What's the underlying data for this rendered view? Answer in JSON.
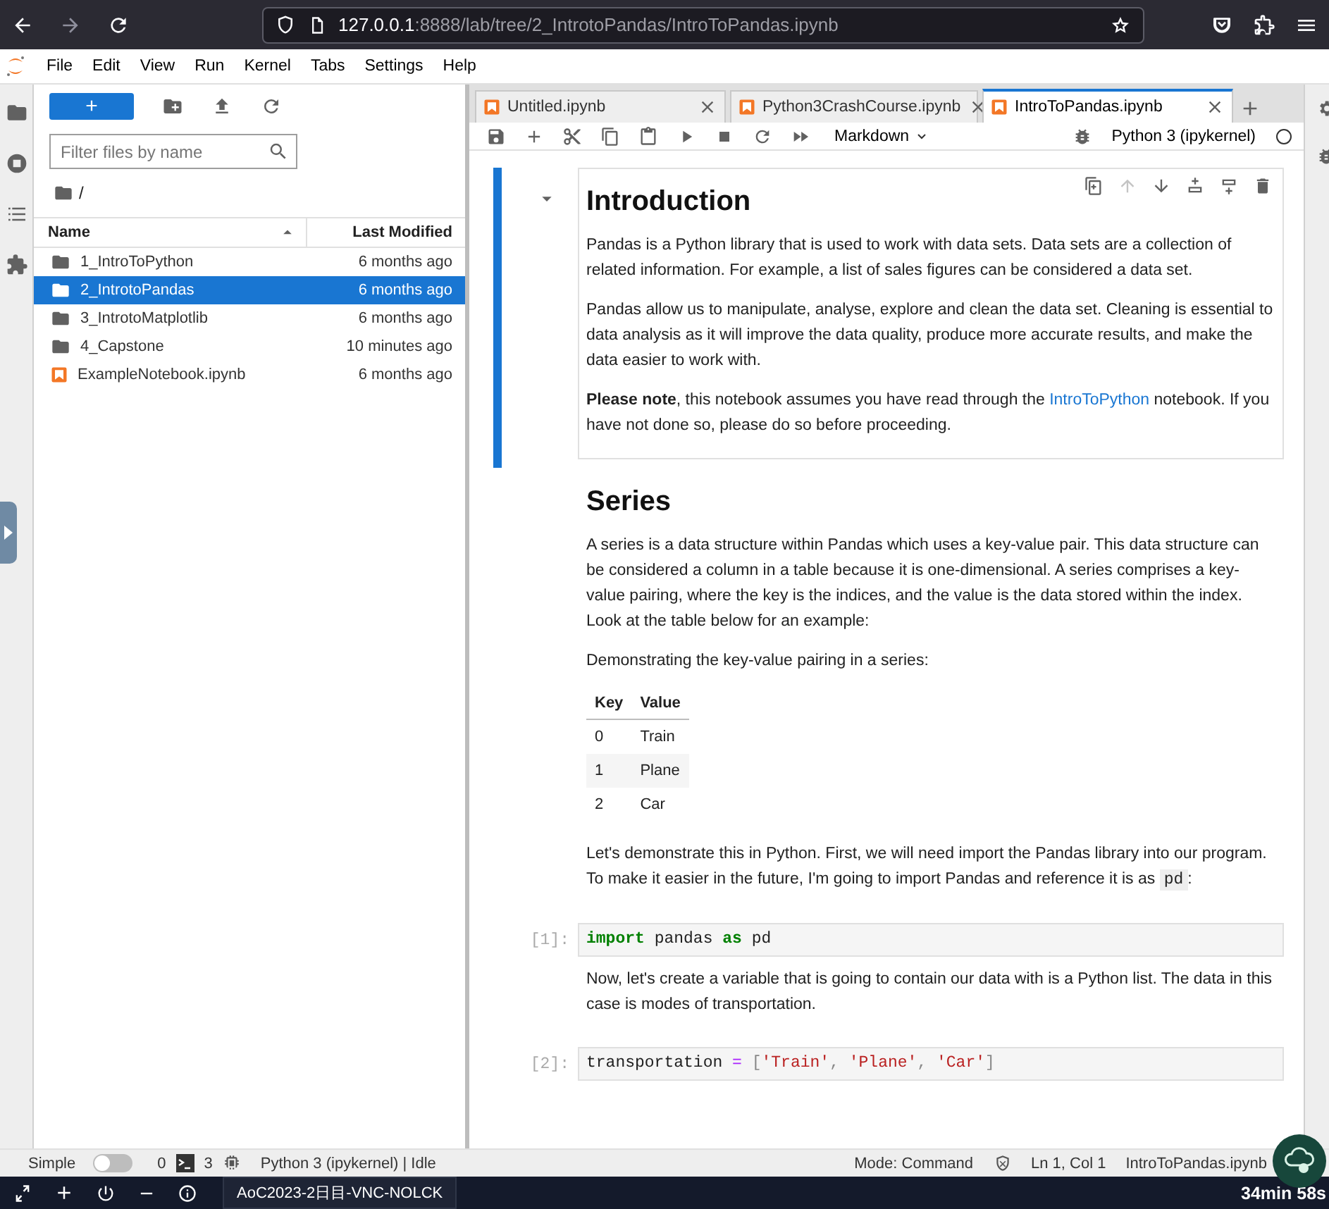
{
  "browser": {
    "url_host": "127.0.0.1",
    "url_path": ":8888/lab/tree/2_IntrotoPandas/IntroToPandas.ipynb"
  },
  "menu": [
    "File",
    "Edit",
    "View",
    "Run",
    "Kernel",
    "Tabs",
    "Settings",
    "Help"
  ],
  "file_browser": {
    "new_button": "+",
    "filter": {
      "placeholder": "Filter files by name"
    },
    "breadcrumb": "/",
    "columns": [
      "Name",
      "Last Modified"
    ],
    "files": [
      {
        "name": "1_IntroToPython",
        "modified": "6 months ago",
        "kind": "folder",
        "selected": false
      },
      {
        "name": "2_IntrotoPandas",
        "modified": "6 months ago",
        "kind": "folder",
        "selected": true
      },
      {
        "name": "3_IntrotoMatplotlib",
        "modified": "6 months ago",
        "kind": "folder",
        "selected": false
      },
      {
        "name": "4_Capstone",
        "modified": "10 minutes ago",
        "kind": "folder",
        "selected": false
      },
      {
        "name": "ExampleNotebook.ipynb",
        "modified": "6 months ago",
        "kind": "notebook",
        "selected": false
      }
    ]
  },
  "tabs": [
    {
      "label": "Untitled.ipynb",
      "selected": false
    },
    {
      "label": "Python3CrashCourse.ipynb",
      "selected": false
    },
    {
      "label": "IntroToPandas.ipynb",
      "selected": true
    }
  ],
  "toolbar": {
    "cell_type": "Markdown",
    "kernel": "Python 3 (ipykernel)"
  },
  "cell_toolbar": [
    {
      "kind": "duplicate",
      "disabled": false
    },
    {
      "kind": "move_up",
      "disabled": true
    },
    {
      "kind": "move_down",
      "disabled": false
    },
    {
      "kind": "insert_above",
      "disabled": false
    },
    {
      "kind": "insert_below",
      "disabled": false
    },
    {
      "kind": "delete",
      "disabled": false
    }
  ],
  "cells": [
    {
      "kind": "markdown",
      "active": true,
      "blocks": [
        {
          "kind": "heading",
          "text": "Introduction"
        },
        {
          "kind": "paragraph",
          "parts": [
            {
              "kind": "text",
              "text": "Pandas is a Python library that is used to work with data sets. Data sets are a collection of related information. For example, a list of sales figures can be considered a data set."
            }
          ]
        },
        {
          "kind": "paragraph",
          "parts": [
            {
              "kind": "text",
              "text": "Pandas allow us to manipulate, analyse, explore and clean the data set. Cleaning is essential to data analysis as it will improve the data quality, produce more accurate results, and make the data easier to work with."
            }
          ]
        },
        {
          "kind": "paragraph",
          "parts": [
            {
              "kind": "bold",
              "text": "Please note"
            },
            {
              "kind": "text",
              "text": ", this notebook assumes you have read through the "
            },
            {
              "kind": "link",
              "text": "IntroToPython"
            },
            {
              "kind": "text",
              "text": " notebook. If you have not done so, please do so before proceeding."
            }
          ]
        }
      ]
    },
    {
      "kind": "markdown",
      "active": false,
      "blocks": [
        {
          "kind": "heading",
          "text": "Series"
        },
        {
          "kind": "paragraph",
          "parts": [
            {
              "kind": "text",
              "text": "A series is a data structure within Pandas which uses a key-value pair. This data structure can be considered a column in a table because it is one-dimensional. A series comprises a key-value pairing, where the key is the indices, and the value is the data stored within the index. Look at the table below for an example:"
            }
          ]
        },
        {
          "kind": "paragraph",
          "parts": [
            {
              "kind": "text",
              "text": "Demonstrating the key-value pairing in a series:"
            }
          ]
        },
        {
          "kind": "table",
          "columns": [
            "Key",
            "Value"
          ],
          "rows": [
            [
              "0",
              "Train"
            ],
            [
              "1",
              "Plane"
            ],
            [
              "2",
              "Car"
            ]
          ]
        },
        {
          "kind": "paragraph",
          "parts": [
            {
              "kind": "text",
              "text": "Let's demonstrate this in Python. First, we will need import the Pandas library into our program. To make it easier in the future, I'm going to import Pandas and reference it is as "
            },
            {
              "kind": "code",
              "text": "pd"
            },
            {
              "kind": "text",
              "text": ":"
            }
          ]
        }
      ]
    },
    {
      "kind": "code",
      "active": false,
      "prompt": "[1]:",
      "tokens": [
        {
          "kind": "keyword",
          "text": "import"
        },
        {
          "kind": "name",
          "text": " pandas "
        },
        {
          "kind": "keyword",
          "text": "as"
        },
        {
          "kind": "name",
          "text": " pd"
        }
      ]
    },
    {
      "kind": "markdown",
      "active": false,
      "blocks": [
        {
          "kind": "paragraph",
          "parts": [
            {
              "kind": "text",
              "text": "Now, let's create a variable that is going to contain our data with is a Python list. The data in this case is modes of transportation."
            }
          ]
        }
      ]
    },
    {
      "kind": "code",
      "active": false,
      "prompt": "[2]:",
      "tokens": [
        {
          "kind": "name",
          "text": "transportation "
        },
        {
          "kind": "operator",
          "text": "="
        },
        {
          "kind": "punct",
          "text": " ["
        },
        {
          "kind": "string",
          "text": "'Train'"
        },
        {
          "kind": "punct",
          "text": ", "
        },
        {
          "kind": "string",
          "text": "'Plane'"
        },
        {
          "kind": "punct",
          "text": ", "
        },
        {
          "kind": "string",
          "text": "'Car'"
        },
        {
          "kind": "punct",
          "text": "]"
        }
      ]
    }
  ],
  "status_bar": {
    "simple_mode": {
      "label": "Simple",
      "on": false
    },
    "terminals": "0",
    "kernels": "3",
    "kernel_status": "Python 3 (ipykernel) | Idle",
    "mode": "Mode: Command",
    "position": "Ln 1, Col 1",
    "file": "IntroToPandas.ipynb"
  },
  "taskbar": {
    "session": "AoC2023-2日目-VNC-NOLCK",
    "timer": "34min 58s"
  }
}
